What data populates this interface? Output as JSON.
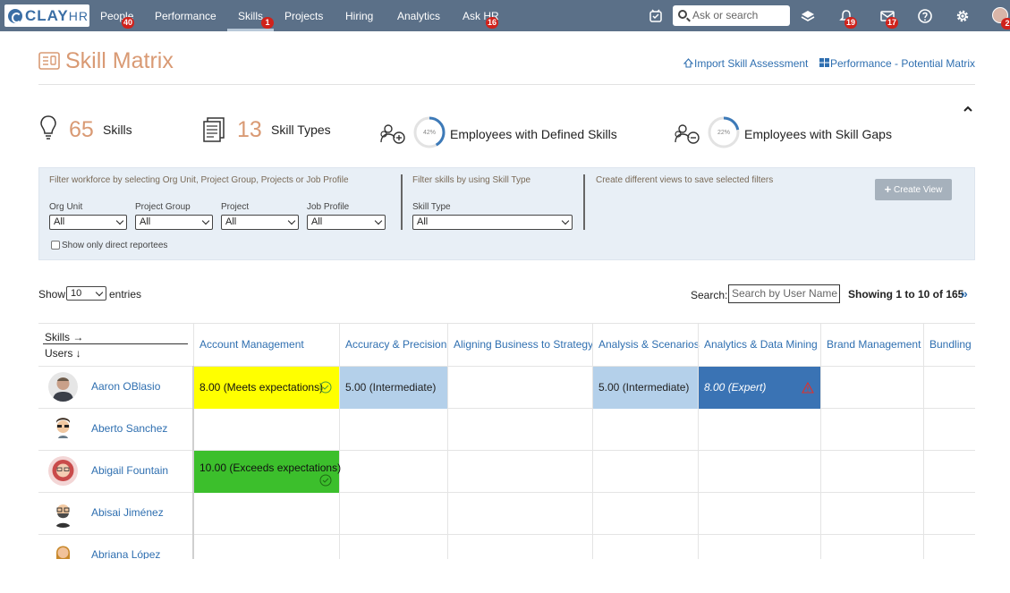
{
  "brand": {
    "logo_main": "CLAY",
    "logo_sub": "HR"
  },
  "nav": {
    "items": [
      {
        "label": "People",
        "badge": "40"
      },
      {
        "label": "Performance",
        "badge": ""
      },
      {
        "label": "Skills",
        "badge": "1"
      },
      {
        "label": "Projects",
        "badge": ""
      },
      {
        "label": "Hiring",
        "badge": ""
      },
      {
        "label": "Analytics",
        "badge": ""
      },
      {
        "label": "Ask HR",
        "badge": "16"
      }
    ],
    "search_placeholder": "Ask or search",
    "notifications_badge": "19",
    "messages_badge": "17",
    "profile_badge": "2"
  },
  "page": {
    "title": "Skill Matrix",
    "import_link": "Import Skill Assessment",
    "matrix_link": "Performance - Potential Matrix"
  },
  "stats": {
    "skills_count": "65",
    "skills_label": "Skills",
    "types_count": "13",
    "types_label": "Skill Types",
    "defined_pct_text": "42%",
    "defined_pct": 0.42,
    "defined_label": "Employees with Defined Skills",
    "gaps_pct_text": "22%",
    "gaps_pct": 0.22,
    "gaps_label": "Employees with Skill Gaps"
  },
  "filters": {
    "hint_workforce": "Filter workforce by selecting Org Unit, Project Group, Projects or Job Profile",
    "hint_skills": "Filter skills by using Skill Type",
    "hint_views": "Create different views to save selected filters",
    "org_unit_label": "Org Unit",
    "org_unit_value": "All",
    "project_group_label": "Project Group",
    "project_group_value": "All",
    "project_label": "Project",
    "project_value": "All",
    "job_profile_label": "Job Profile",
    "job_profile_value": "All",
    "skill_type_label": "Skill Type",
    "skill_type_value": "All",
    "direct_reportees_label": "Show only direct reportees",
    "create_view_label": "Create View"
  },
  "table_controls": {
    "show_label": "Show",
    "entries_value": "10",
    "entries_label": "entries",
    "search_label": "Search:",
    "search_placeholder": "Search by User Name",
    "showing_text": "Showing 1 to 10 of 165",
    "next_label": "»"
  },
  "matrix": {
    "corner_skills": "Skills →",
    "corner_users": "Users ↓",
    "skills": [
      "Account Management",
      "Accuracy & Precision",
      "Aligning Business to Strategy",
      "Analysis & Scenarios",
      "Analytics & Data Mining",
      "Brand Management",
      "Bundling"
    ],
    "users": [
      {
        "name": "Aaron OBlasio"
      },
      {
        "name": "Aberto Sanchez"
      },
      {
        "name": "Abigail Fountain"
      },
      {
        "name": "Abisai Jiménez"
      },
      {
        "name": "Abriana López"
      }
    ],
    "scores": {
      "r0c0": "8.00 (Meets expectations)",
      "r0c1": "5.00 (Intermediate)",
      "r0c3": "5.00 (Intermediate)",
      "r0c4": "8.00 (Expert)",
      "r2c0": "10.00 (Exceeds expectations)"
    },
    "colors": {
      "meets": "#ffff00",
      "exceeds": "#3cbf2c",
      "intermediate": "#b4d0ea",
      "expert": "#3a73b4"
    }
  }
}
